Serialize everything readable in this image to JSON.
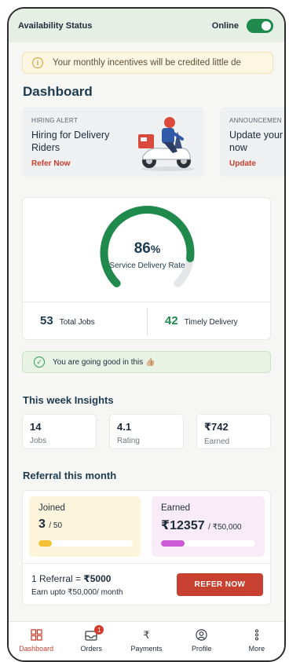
{
  "status_bar": {
    "title": "Availability Status",
    "online_label": "Online",
    "online": true
  },
  "notice": {
    "text": "Your monthly incentives will be credited little de"
  },
  "dashboard": {
    "title": "Dashboard"
  },
  "alerts": [
    {
      "kicker": "HIRING ALERT",
      "headline": "Hiring for Delivery Riders",
      "cta": "Refer Now"
    },
    {
      "kicker": "ANNOUNCEMEN",
      "headline": "Update your now",
      "cta": "Update"
    }
  ],
  "performance": {
    "percent": "86",
    "percent_suffix": "%",
    "rate_label": "Service Delivery Rate",
    "rate_fraction": 0.86,
    "total_jobs": {
      "value": "53",
      "label": "Total Jobs"
    },
    "timely": {
      "value": "42",
      "label": "Timely Delivery"
    }
  },
  "good_message": "You are going good in this 👍🏼",
  "insights": {
    "title": "This week Insights",
    "items": [
      {
        "value": "14",
        "label": "Jobs"
      },
      {
        "value": "4.1",
        "label": "Rating"
      },
      {
        "value": "₹742",
        "label": "Earned"
      }
    ]
  },
  "referral": {
    "title": "Referral this month",
    "joined": {
      "label": "Joined",
      "value": "3",
      "of": "/ 50",
      "progress": 0.06,
      "color": "#f2c033"
    },
    "earned": {
      "label": "Earned",
      "value": "₹12357",
      "of": "/ ₹50,000",
      "progress": 0.25,
      "color": "#cc5ad6"
    },
    "rule_prefix": "1 Referral = ",
    "rule_amount": "₹5000",
    "upto": "Earn upto ₹50,000/ month",
    "button": "REFER NOW"
  },
  "nav": [
    {
      "label": "Dashboard",
      "icon": "grid-icon"
    },
    {
      "label": "Orders",
      "icon": "inbox-icon",
      "badge": "1"
    },
    {
      "label": "Payments",
      "icon": "rupee-icon"
    },
    {
      "label": "Profile",
      "icon": "user-icon"
    },
    {
      "label": "More",
      "icon": "more-vertical-icon"
    }
  ],
  "colors": {
    "accent": "#c8402f",
    "green": "#1f8a4c",
    "gauge_track": "#e4e6e8"
  }
}
